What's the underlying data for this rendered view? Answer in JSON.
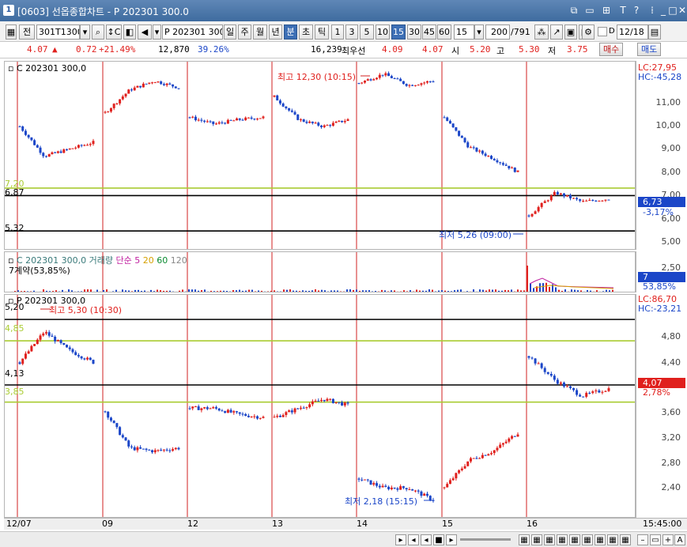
{
  "window": {
    "logo": "1",
    "title": "[0603] 선옵종합차트 - P 202301 300.0",
    "controls": [
      "⧉",
      "▭",
      "⊞",
      "T",
      "?",
      "⁞",
      "_",
      "□",
      "✕"
    ]
  },
  "toolbar": {
    "market": "전",
    "code": "301T1300",
    "name_field": "P 202301 300",
    "periods": [
      "일",
      "주",
      "월",
      "년",
      "분",
      "초",
      "틱"
    ],
    "selected_period": "분",
    "intervals": [
      "1",
      "3",
      "5",
      "10",
      "15",
      "30",
      "45",
      "60"
    ],
    "selected_interval": "15",
    "interval_value": "15",
    "count": "200",
    "total": "/791",
    "date_checkbox_label": "D",
    "date": "12/18"
  },
  "quote": {
    "price": "4.07",
    "change_arrow": "▲",
    "change": "0.72",
    "change_pct": "+21.49%",
    "volume": "12,870",
    "volume_ratio": "39.26%",
    "open_interest": "16,239",
    "best_bid_label": "최우선",
    "best_bid": "4.09",
    "best_ask": "4.07",
    "open_label": "시",
    "open": "5.20",
    "high_label": "고",
    "high": "5.30",
    "low_label": "저",
    "low": "3.75",
    "buy_label": "매수",
    "sell_label": "매도"
  },
  "panels": {
    "call": {
      "legend": "C 202301 300,0",
      "lc": "LC:27,95",
      "hc": "HC:-45,28",
      "current": "6,73",
      "current_pct": "-3,17%",
      "levels": [
        {
          "label": "7,20",
          "color": "#aacc33"
        },
        {
          "label": "6,87",
          "color": "#000000"
        },
        {
          "label": "5,32",
          "color": "#000000"
        }
      ],
      "high_note": "최고 12,30 (10:15)",
      "low_note": "최저 5,26 (09:00)",
      "ticks": [
        "11,00",
        "10,00",
        "9,00",
        "8,00",
        "7,00",
        "6,00",
        "5,00"
      ]
    },
    "volume": {
      "legend_main": "C 202301 300,0 거래량",
      "ma_label": "단순",
      "ma": [
        "5",
        "20",
        "60",
        "120"
      ],
      "sub": "7계약(53,85%)",
      "ticks": [
        "2,50"
      ],
      "box1": "7",
      "box2": "53,85%"
    },
    "put": {
      "legend": "P 202301 300,0",
      "lc": "LC:86,70",
      "hc": "HC:-23,21",
      "current": "4,07",
      "current_pct": "2,78%",
      "levels": [
        {
          "label": "5,20",
          "color": "#000000"
        },
        {
          "label": "4,85",
          "color": "#aacc33"
        },
        {
          "label": "4,13",
          "color": "#000000"
        },
        {
          "label": "3,85",
          "color": "#aacc33"
        }
      ],
      "high_note": "최고 5,30 (10:30)",
      "low_note": "최저 2,18 (15:15)",
      "ticks": [
        "4,80",
        "4,40",
        "3,60",
        "3,20",
        "2,80",
        "2,40"
      ]
    }
  },
  "dates": [
    "12/07",
    "09",
    "12",
    "13",
    "14",
    "15",
    "16"
  ],
  "time_label": "15:45:00",
  "chart_data": [
    {
      "type": "candlestick",
      "title": "C 202301 300,0",
      "ylim": [
        4.6,
        12.6
      ],
      "sessions": [
        "12/07",
        "09",
        "12",
        "13",
        "14",
        "15",
        "16"
      ],
      "close_approx": [
        [
          9.9,
          8.6,
          8.9,
          9.2
        ],
        [
          10.5,
          11.5,
          11.9,
          11.6
        ],
        [
          10.3,
          10.0,
          10.2,
          10.3
        ],
        [
          11.2,
          10.2,
          9.9,
          10.2
        ],
        [
          11.8,
          12.2,
          11.7,
          11.9
        ],
        [
          10.3,
          9.0,
          8.5,
          7.9
        ],
        [
          6.0,
          7.0,
          6.6,
          6.73
        ]
      ],
      "hlines": [
        7.2,
        6.87,
        5.32
      ]
    },
    {
      "type": "bar",
      "title": "C 202301 300,0 거래량",
      "series_last": 7
    },
    {
      "type": "candlestick",
      "title": "P 202301 300,0",
      "ylim": [
        2.0,
        5.55
      ],
      "sessions": [
        "12/07",
        "09",
        "12",
        "13",
        "14",
        "15",
        "16"
      ],
      "close_approx": [
        [
          4.5,
          5.0,
          4.7,
          4.5
        ],
        [
          3.7,
          3.1,
          3.05,
          3.1
        ],
        [
          3.75,
          3.75,
          3.65,
          3.6
        ],
        [
          3.6,
          3.75,
          3.9,
          3.8
        ],
        [
          2.6,
          2.45,
          2.45,
          2.25
        ],
        [
          2.45,
          2.9,
          3.05,
          3.35
        ],
        [
          4.6,
          4.2,
          3.95,
          4.07
        ]
      ],
      "hlines": [
        5.2,
        4.85,
        4.13,
        3.85
      ]
    }
  ]
}
